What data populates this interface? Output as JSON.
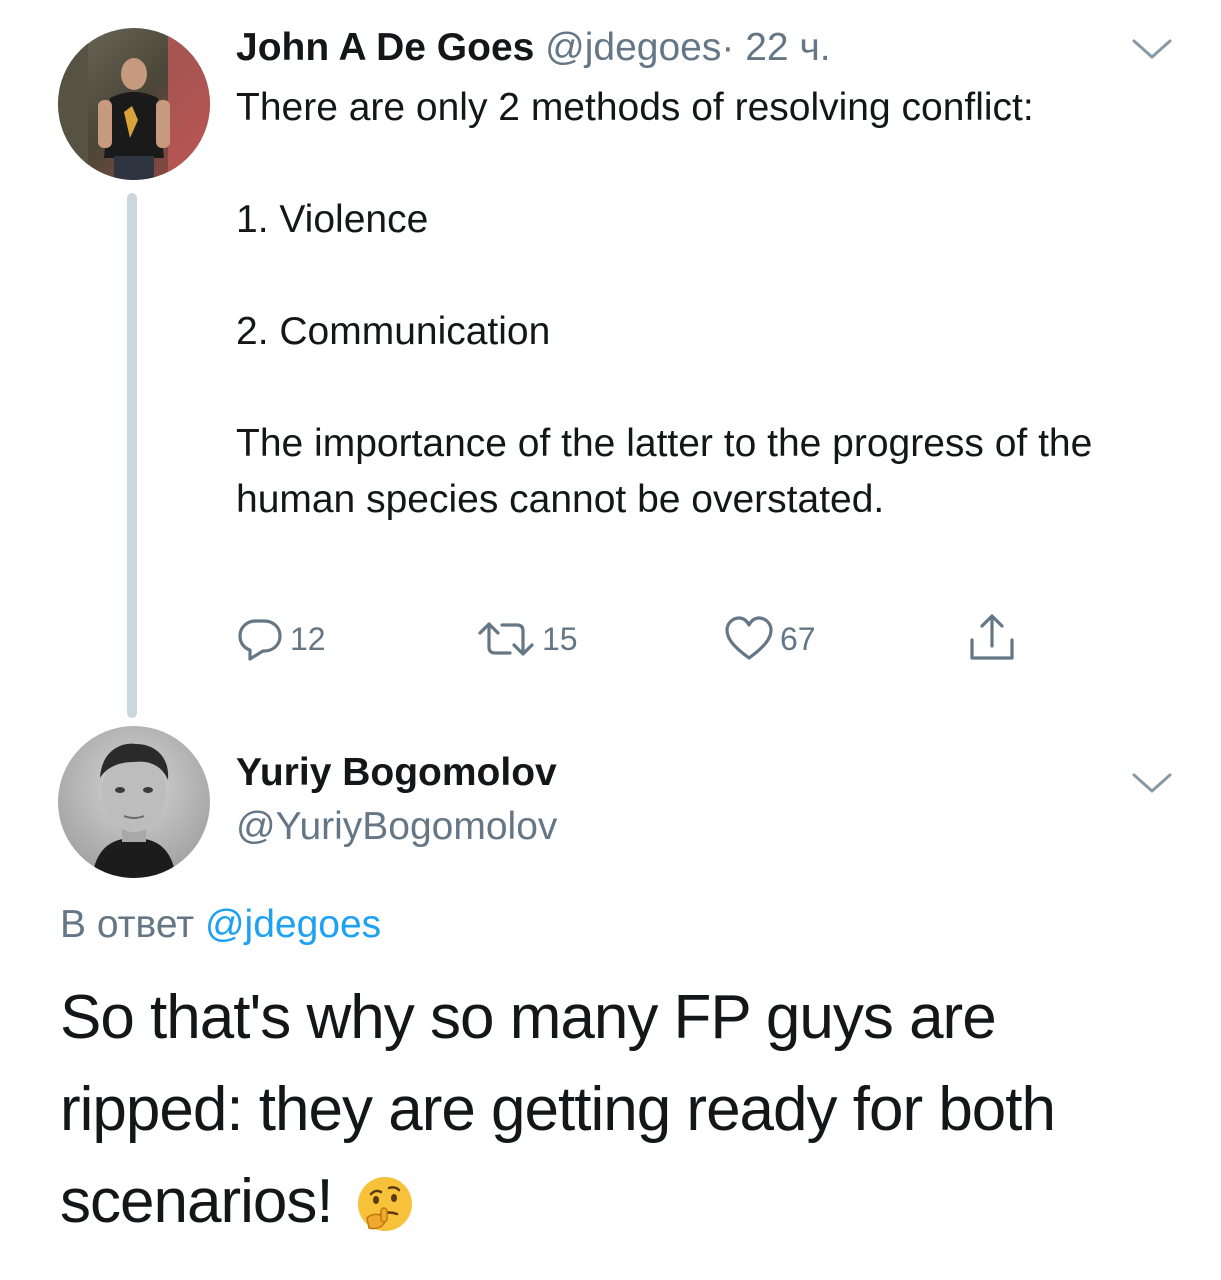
{
  "original_tweet": {
    "author_name": "John A De Goes",
    "handle": "@jdegoes",
    "separator": "·",
    "time": "22 ч.",
    "text_lines": [
      "There are only 2 methods of resolving conflict:",
      "1. Violence",
      "2. Communication",
      "The importance of the latter to the progress of the human species cannot be overstated."
    ],
    "actions": {
      "reply_count": "12",
      "retweet_count": "15",
      "like_count": "67"
    }
  },
  "reply_tweet": {
    "author_name": "Yuriy Bogomolov",
    "handle": "@YuriyBogomolov",
    "reply_prefix": "В ответ",
    "reply_to_handle": "@jdegoes",
    "text": "So that's why so many FP guys are ripped: they are getting ready for both scenarios!"
  },
  "icons": {
    "reply": "speech-bubble-icon",
    "retweet": "retweet-icon",
    "like": "heart-icon",
    "share": "share-icon",
    "menu": "chevron-down-icon",
    "emoji": "thinking-face-emoji"
  },
  "colors": {
    "text": "#14171a",
    "muted": "#657786",
    "link": "#1da1f2",
    "thread_line": "#ccd6dd"
  }
}
